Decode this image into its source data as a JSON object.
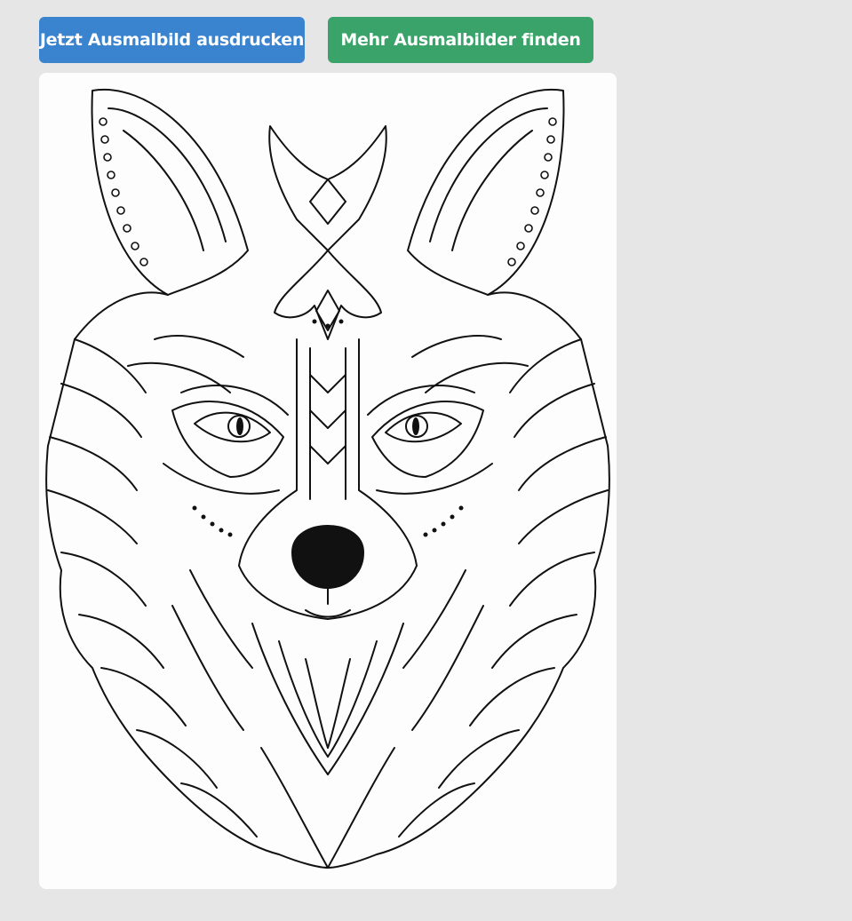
{
  "colors": {
    "page_background": "#e6e6e6",
    "print_button": "#3a83cf",
    "more_button": "#3aa36a",
    "card_background": "#fdfdfd",
    "line_art": "#111111"
  },
  "actions": {
    "print_label": "Jetzt Ausmalbild ausdrucken",
    "more_label": "Mehr Ausmalbilder finden"
  },
  "image": {
    "subject": "mandala-fox-coloring-page",
    "style": "black-and-white line art"
  }
}
